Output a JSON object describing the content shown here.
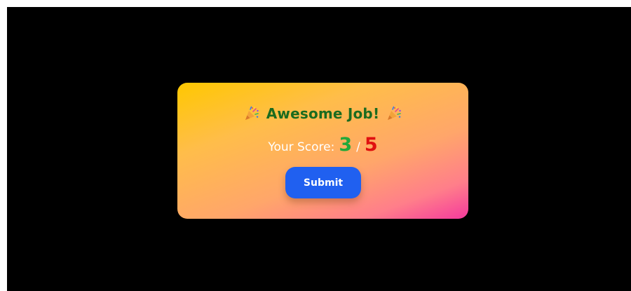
{
  "result_card": {
    "title": "Awesome Job!",
    "left_icon": "party-popper-icon",
    "right_icon": "party-popper-icon",
    "score_label": "Your Score:",
    "score_value": "3",
    "score_separator": "/",
    "score_total": "5",
    "submit_label": "Submit"
  },
  "colors": {
    "background": "#000000",
    "card_gradient_start": "#ffc800",
    "card_gradient_end": "#f53a9d",
    "title": "#1b6b1f",
    "score_value": "#22a83a",
    "score_total": "#e01010",
    "button": "#2060f0"
  }
}
